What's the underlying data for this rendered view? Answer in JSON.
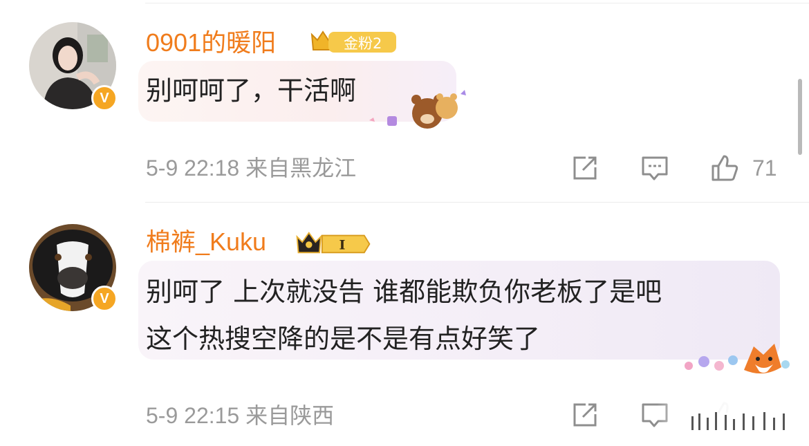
{
  "comments": [
    {
      "username": "0901的暖阳",
      "badge_label": "金粉2",
      "text": "别呵呵了，干活啊",
      "meta": "5-9 22:18  来自黑龙江",
      "likes": "71",
      "verified_mark": "V",
      "avatar_icon": "user-avatar-photo",
      "sticker_icon": "bear-sticker-icon"
    },
    {
      "username": "棉裤_Kuku",
      "badge_label": "I",
      "text_line1": "别呵了 上次就没告 谁都能欺负你老板了是吧",
      "text_line2": "这个热搜空降的是不是有点好笑了",
      "meta": "5-9 22:15  来自陕西",
      "likes": "",
      "verified_mark": "V",
      "avatar_icon": "dog-avatar-photo",
      "sticker_icon": "fox-flowers-sticker-icon"
    }
  ],
  "colors": {
    "username": "#f07c1c",
    "meta": "#9a9a9a",
    "verified": "#f5a623",
    "badge_gold": "#f0b429"
  }
}
